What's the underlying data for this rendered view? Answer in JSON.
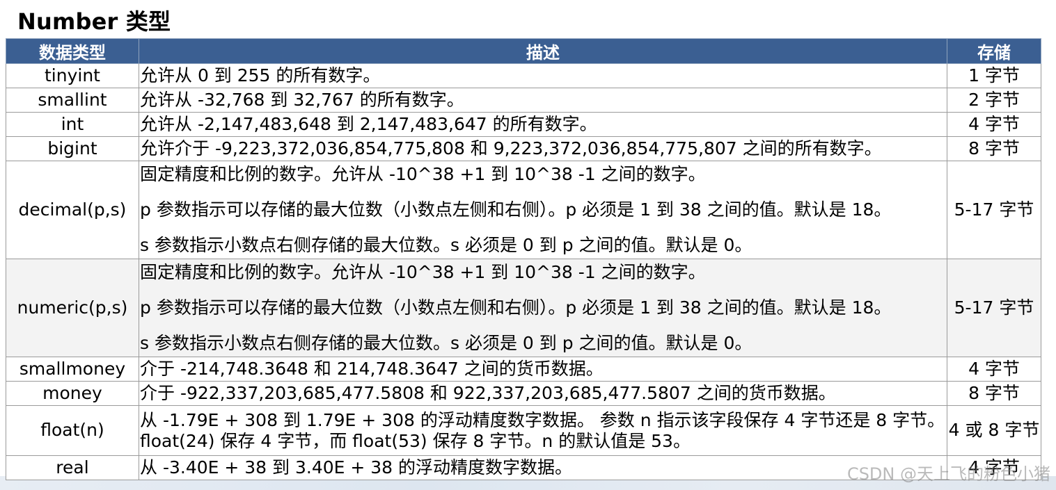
{
  "title": "Number 类型",
  "table": {
    "headers": [
      "数据类型",
      "描述",
      "存储"
    ],
    "rows": [
      {
        "type": "tinyint",
        "desc": [
          "允许从 0 到 255 的所有数字。"
        ],
        "storage": "1 字节"
      },
      {
        "type": "smallint",
        "desc": [
          "允许从 -32,768 到 32,767 的所有数字。"
        ],
        "storage": "2 字节"
      },
      {
        "type": "int",
        "desc": [
          "允许从 -2,147,483,648 到 2,147,483,647 的所有数字。"
        ],
        "storage": "4 字节"
      },
      {
        "type": "bigint",
        "desc": [
          "允许介于 -9,223,372,036,854,775,808 和 9,223,372,036,854,775,807 之间的所有数字。"
        ],
        "storage": "8 字节"
      },
      {
        "type": "decimal(p,s)",
        "desc": [
          "固定精度和比例的数字。允许从 -10^38 +1 到 10^38 -1 之间的数字。",
          "p 参数指示可以存储的最大位数（小数点左侧和右侧）。p 必须是 1 到 38 之间的值。默认是 18。",
          "s 参数指示小数点右侧存储的最大位数。s 必须是 0 到 p 之间的值。默认是 0。"
        ],
        "storage": "5-17 字节"
      },
      {
        "type": "numeric(p,s)",
        "desc": [
          "固定精度和比例的数字。允许从 -10^38 +1 到 10^38 -1 之间的数字。",
          "p 参数指示可以存储的最大位数（小数点左侧和右侧）。p 必须是 1 到 38 之间的值。默认是 18。",
          "s 参数指示小数点右侧存储的最大位数。s 必须是 0 到 p 之间的值。默认是 0。"
        ],
        "storage": "5-17 字节"
      },
      {
        "type": "smallmoney",
        "desc": [
          "介于 -214,748.3648 和 214,748.3647 之间的货币数据。"
        ],
        "storage": "4 字节"
      },
      {
        "type": "money",
        "desc": [
          "介于 -922,337,203,685,477.5808 和 922,337,203,685,477.5807 之间的货币数据。"
        ],
        "storage": "8 字节"
      },
      {
        "type": "float(n)",
        "desc": [
          "从 -1.79E + 308 到 1.79E + 308 的浮动精度数字数据。 参数 n 指示该字段保存 4 字节还是 8 字节。",
          "float(24) 保存 4 字节，而 float(53) 保存 8 字节。n 的默认值是 53。"
        ],
        "storage": "4 或 8 字节"
      },
      {
        "type": "real",
        "desc": [
          "从 -3.40E + 38 到 3.40E + 38 的浮动精度数字数据。"
        ],
        "storage": "4 字节"
      }
    ]
  },
  "watermark": "CSDN @天上飞的粉色小猪"
}
